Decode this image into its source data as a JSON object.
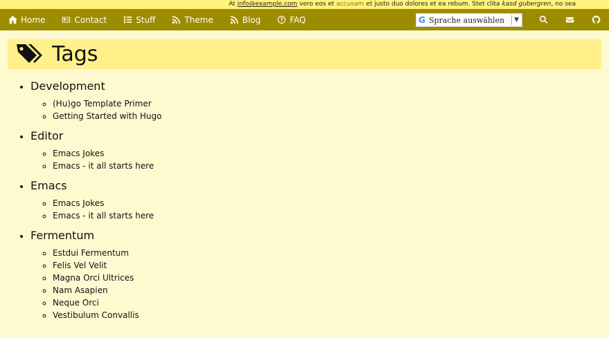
{
  "topbar": {
    "text_1": "At",
    "email": "info@example.com",
    "text_2": "vero eos et",
    "highlight": "accusam",
    "text_3": "et justo duo dolores et ea rebum. Stet clita",
    "italic": "kasd gubergren",
    "text_4": ", no sea"
  },
  "nav": {
    "home": "Home",
    "contact": "Contact",
    "stuff": "Stuff",
    "theme": "Theme",
    "blog": "Blog",
    "faq": "FAQ",
    "translate_label": "Sprache auswählen",
    "translate_g": "G",
    "translate_arrow": "▼"
  },
  "page": {
    "title": "Tags"
  },
  "tags": [
    {
      "name": "Development",
      "posts": [
        "(Hu)go Template Primer",
        "Getting Started with Hugo"
      ]
    },
    {
      "name": "Editor",
      "posts": [
        "Emacs Jokes",
        "Emacs - it all starts here"
      ]
    },
    {
      "name": "Emacs",
      "posts": [
        "Emacs Jokes",
        "Emacs - it all starts here"
      ]
    },
    {
      "name": "Fermentum",
      "posts": [
        "Estdui Fermentum",
        "Felis Vel Velit",
        "Magna Orci Ultrices",
        "Nam Asapien",
        "Neque Orci",
        "Vestibulum Convallis"
      ]
    }
  ],
  "colors": {
    "navbar": "#9e8c00",
    "topbar": "#fff37a",
    "title_box": "#fff08a",
    "background": "#fff9d0"
  }
}
